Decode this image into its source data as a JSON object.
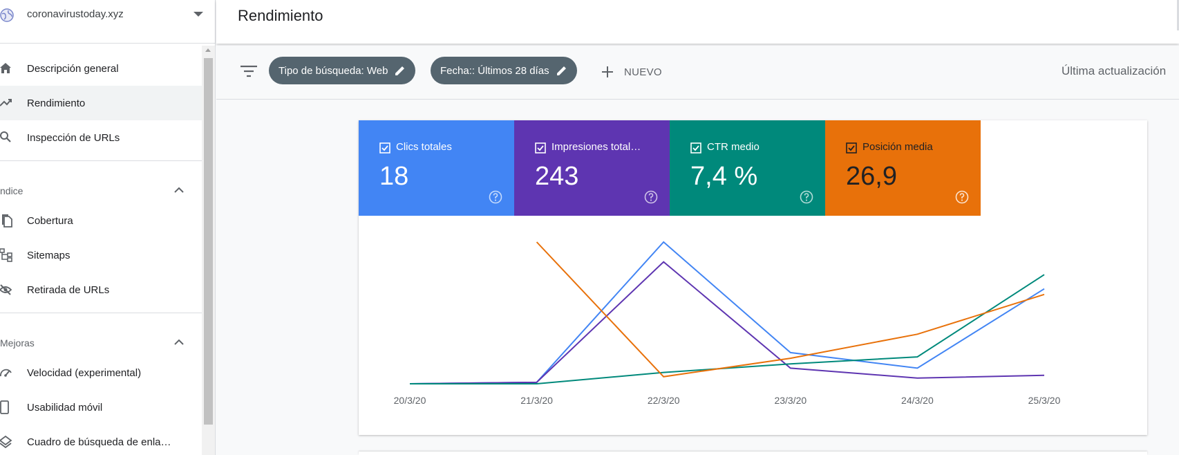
{
  "sidebar": {
    "property": "coronavirustoday.xyz",
    "items": [
      {
        "label": "Descripción general",
        "icon": "home-icon"
      },
      {
        "label": "Rendimiento",
        "icon": "trending-up-icon"
      },
      {
        "label": "Inspección de URLs",
        "icon": "search-icon"
      }
    ],
    "sections": [
      {
        "title": "ndice",
        "items": [
          {
            "label": "Cobertura",
            "icon": "coverage-icon"
          },
          {
            "label": "Sitemaps",
            "icon": "sitemap-icon"
          },
          {
            "label": "Retirada de URLs",
            "icon": "eye-off-icon"
          }
        ]
      },
      {
        "title": "Mejoras",
        "items": [
          {
            "label": "Velocidad (experimental)",
            "icon": "speed-icon"
          },
          {
            "label": "Usabilidad móvil",
            "icon": "phone-icon"
          },
          {
            "label": "Cuadro de búsqueda de enla…",
            "icon": "layers-icon"
          }
        ]
      }
    ]
  },
  "header": {
    "title": "Rendimiento"
  },
  "filters": {
    "chips": [
      {
        "label": "Tipo de búsqueda: Web"
      },
      {
        "label": "Fecha:: Últimos 28 días"
      }
    ],
    "new_label": "NUEVO",
    "last_update": "Última actualización"
  },
  "metrics": [
    {
      "label": "Clics totales",
      "value": "18",
      "color": "#4285f4"
    },
    {
      "label": "Impresiones total…",
      "value": "243",
      "color": "#5e35b1"
    },
    {
      "label": "CTR medio",
      "value": "7,4 %",
      "color": "#00897b"
    },
    {
      "label": "Posición media",
      "value": "26,9",
      "color": "#e8710a"
    }
  ],
  "chart_data": {
    "type": "line",
    "categories": [
      "20/3/20",
      "21/3/20",
      "22/3/20",
      "23/3/20",
      "24/3/20",
      "25/3/20"
    ],
    "series": [
      {
        "name": "Clics totales",
        "color": "#4285f4",
        "values": [
          0.0,
          0.01,
          1.0,
          0.22,
          0.11,
          0.67
        ]
      },
      {
        "name": "Impresiones total…",
        "color": "#5e35b1",
        "values": [
          0.0,
          0.01,
          0.86,
          0.11,
          0.04,
          0.06
        ]
      },
      {
        "name": "CTR medio",
        "color": "#00897b",
        "values": [
          0.0,
          0.0,
          0.08,
          0.14,
          0.19,
          0.77
        ]
      },
      {
        "name": "Posición media",
        "color": "#e8710a",
        "values": [
          null,
          1.0,
          0.05,
          0.18,
          0.35,
          0.63
        ]
      }
    ]
  }
}
